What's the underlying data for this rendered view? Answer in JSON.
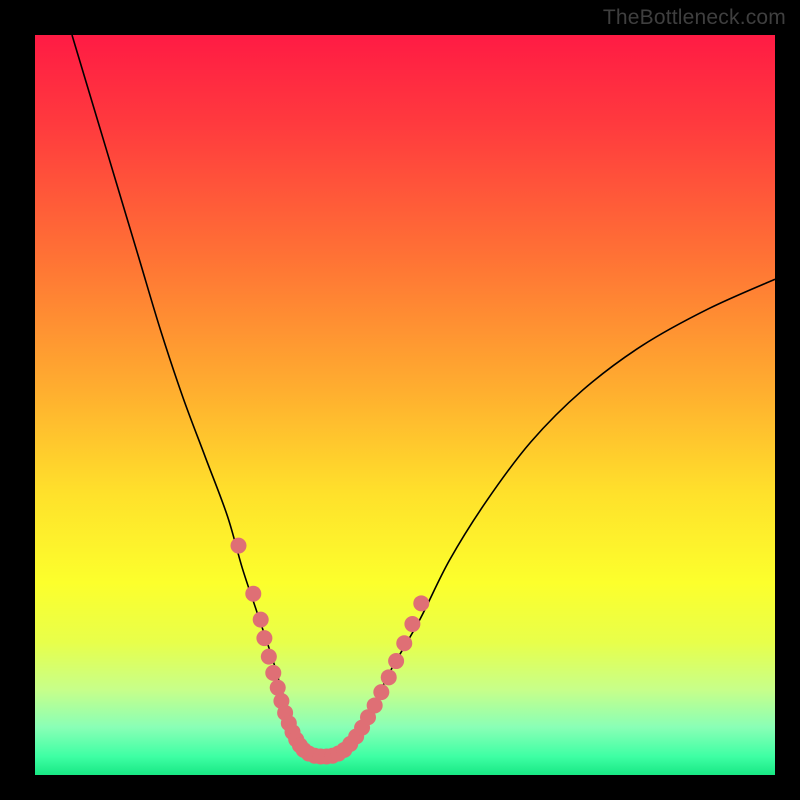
{
  "watermark": "TheBottleneck.com",
  "chart_data": {
    "type": "line",
    "title": "",
    "xlabel": "",
    "ylabel": "",
    "xlim": [
      0,
      100
    ],
    "ylim": [
      0,
      100
    ],
    "grid": false,
    "legend": false,
    "background_gradient": {
      "stops": [
        {
          "offset": 0.0,
          "color": "#ff1b44"
        },
        {
          "offset": 0.12,
          "color": "#ff3a3e"
        },
        {
          "offset": 0.3,
          "color": "#ff7235"
        },
        {
          "offset": 0.48,
          "color": "#ffae2f"
        },
        {
          "offset": 0.62,
          "color": "#ffe12b"
        },
        {
          "offset": 0.74,
          "color": "#fcff2c"
        },
        {
          "offset": 0.82,
          "color": "#e8ff4a"
        },
        {
          "offset": 0.885,
          "color": "#c7ff8a"
        },
        {
          "offset": 0.935,
          "color": "#8affb6"
        },
        {
          "offset": 0.975,
          "color": "#3effa4"
        },
        {
          "offset": 1.0,
          "color": "#18e884"
        }
      ]
    },
    "series": [
      {
        "name": "bottleneck-curve",
        "stroke": "#000000",
        "stroke_width": 1.6,
        "x": [
          5,
          8,
          11,
          14,
          17,
          20,
          23,
          26,
          28,
          30,
          32,
          33.5,
          35,
          36.5,
          38,
          40,
          42,
          45,
          48,
          52,
          56,
          61,
          67,
          74,
          82,
          91,
          100
        ],
        "y": [
          100,
          90,
          80,
          70,
          60,
          51,
          43,
          35,
          28,
          22,
          16,
          11,
          7,
          4,
          2.5,
          2.5,
          4,
          8,
          14,
          21,
          29,
          37,
          45,
          52,
          58,
          63,
          67
        ]
      },
      {
        "name": "highlight-dots-left",
        "type": "scatter",
        "color": "#df6f75",
        "marker_size": 10,
        "x": [
          27.5,
          29.5,
          30.5,
          31,
          31.6,
          32.2,
          32.8,
          33.3,
          33.8,
          34.3,
          34.8,
          35.3,
          35.8,
          36.3
        ],
        "y": [
          31,
          24.5,
          21,
          18.5,
          16,
          13.8,
          11.8,
          10,
          8.4,
          7,
          5.8,
          4.8,
          4,
          3.4
        ]
      },
      {
        "name": "highlight-dots-bottom",
        "type": "scatter",
        "color": "#df6f75",
        "marker_size": 10,
        "x": [
          37,
          37.8,
          38.6,
          39.4,
          40.2,
          41,
          41.8
        ],
        "y": [
          2.9,
          2.6,
          2.5,
          2.5,
          2.6,
          2.9,
          3.4
        ]
      },
      {
        "name": "highlight-dots-right",
        "type": "scatter",
        "color": "#df6f75",
        "marker_size": 10,
        "x": [
          42.6,
          43.4,
          44.2,
          45,
          45.9,
          46.8,
          47.8,
          48.8,
          49.9,
          51,
          52.2
        ],
        "y": [
          4.2,
          5.2,
          6.4,
          7.8,
          9.4,
          11.2,
          13.2,
          15.4,
          17.8,
          20.4,
          23.2
        ]
      }
    ]
  }
}
